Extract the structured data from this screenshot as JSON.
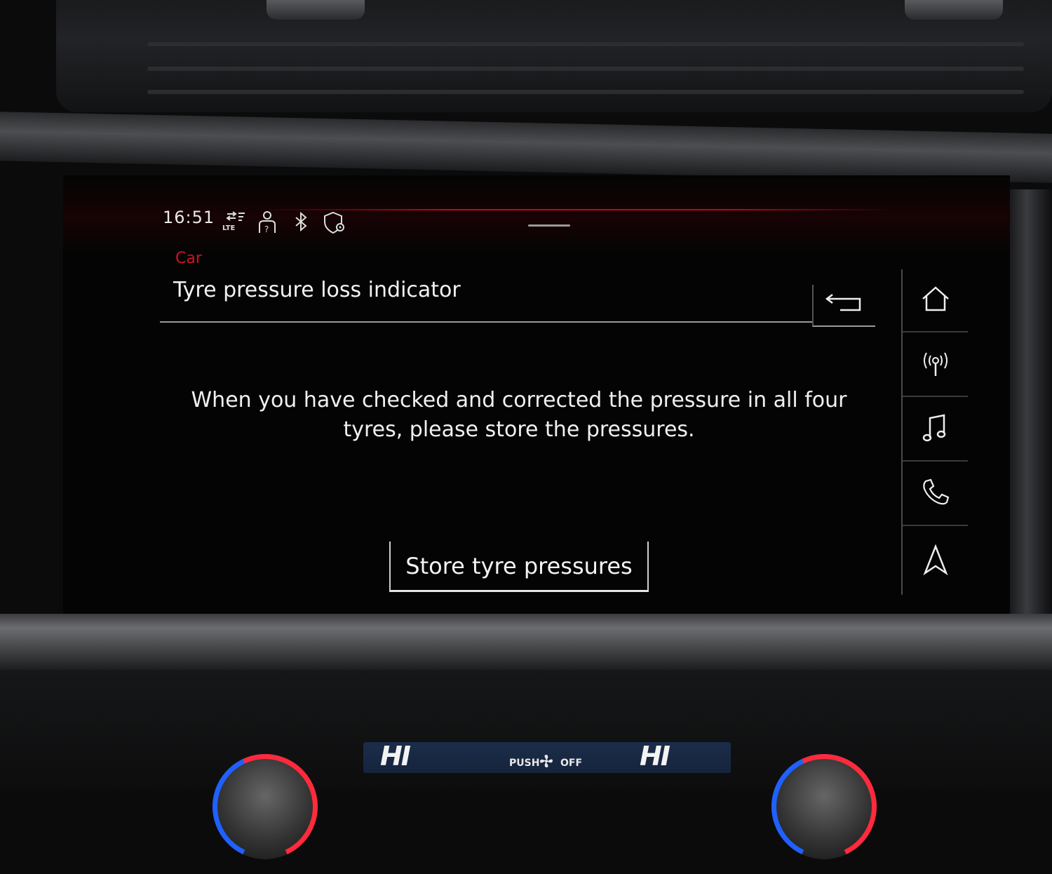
{
  "status_bar": {
    "time": "16:51",
    "icons": [
      "lte-signal-icon",
      "driver-profile-icon",
      "bluetooth-icon",
      "location-shield-icon"
    ],
    "lte_label": "LTE"
  },
  "header": {
    "breadcrumb": "Car",
    "title": "Tyre pressure loss indicator",
    "back_icon": "back-arrow-icon"
  },
  "main": {
    "message": "When you have checked and corrected the pressure in all four tyres, please store the pressures.",
    "store_button_label": "Store tyre pressures"
  },
  "nav_rail": {
    "items": [
      {
        "icon": "home-icon"
      },
      {
        "icon": "radio-icon"
      },
      {
        "icon": "music-icon"
      },
      {
        "icon": "phone-icon"
      },
      {
        "icon": "navigation-icon"
      }
    ]
  },
  "climate": {
    "left_temp": "HI",
    "right_temp": "HI",
    "fan_push_label": "PUSH",
    "fan_off_label": "OFF"
  },
  "colors": {
    "accent_red": "#d01226",
    "text_primary": "#f2f2f2",
    "screen_bg": "#040404"
  }
}
